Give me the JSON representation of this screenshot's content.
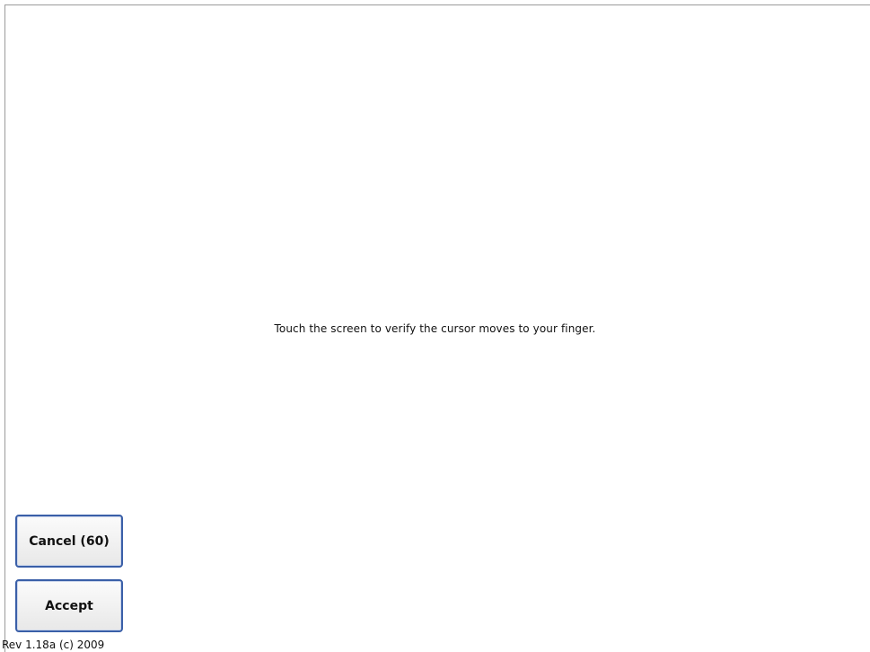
{
  "screen": {
    "instruction": "Touch the screen to verify the cursor moves to your finger.",
    "revision": "Rev 1.18a (c) 2009"
  },
  "buttons": {
    "cancel_label": "Cancel (60)",
    "accept_label": "Accept"
  },
  "colors": {
    "background": "#ffffff",
    "button_border": "#3a5fa8",
    "text": "#111111"
  }
}
